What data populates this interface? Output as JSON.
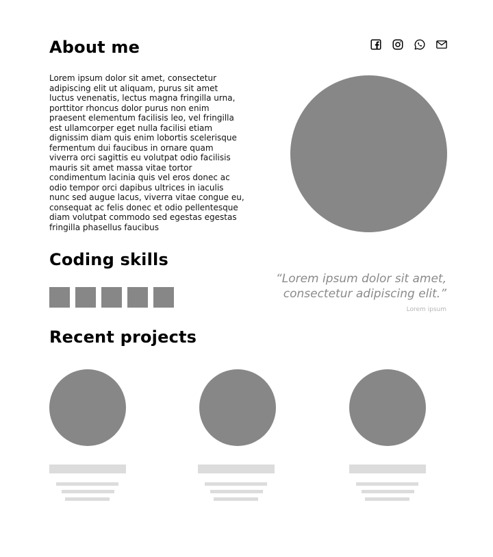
{
  "about": {
    "title": "About me",
    "text": "Lorem ipsum dolor sit amet, consectetur adipiscing elit ut aliquam, purus sit amet luctus venenatis, lectus magna fringilla urna, porttitor rhoncus dolor purus non enim praesent elementum facilisis leo, vel fringilla est ullamcorper eget nulla facilisi etiam dignissim diam quis enim lobortis scelerisque fermentum dui faucibus in ornare quam viverra orci sagittis eu volutpat odio facilisis mauris sit amet massa vitae tortor condimentum lacinia quis vel eros donec ac odio tempor orci dapibus ultrices in iaculis nunc sed augue lacus, viverra vitae congue eu, consequat ac felis donec et odio pellentesque diam volutpat commodo sed egestas egestas fringilla phasellus faucibus"
  },
  "social": {
    "icons": [
      "facebook-icon",
      "instagram-icon",
      "whatsapp-icon",
      "mail-icon"
    ]
  },
  "skills": {
    "title": "Coding skills",
    "count": 5
  },
  "quote": {
    "text": "“Lorem ipsum dolor sit amet, consectetur adipiscing elit.”",
    "author": "Lorem ipsum"
  },
  "projects": {
    "title": "Recent projects",
    "count": 3
  },
  "colors": {
    "placeholder": "#878787",
    "skeleton": "#dcdcdc"
  }
}
